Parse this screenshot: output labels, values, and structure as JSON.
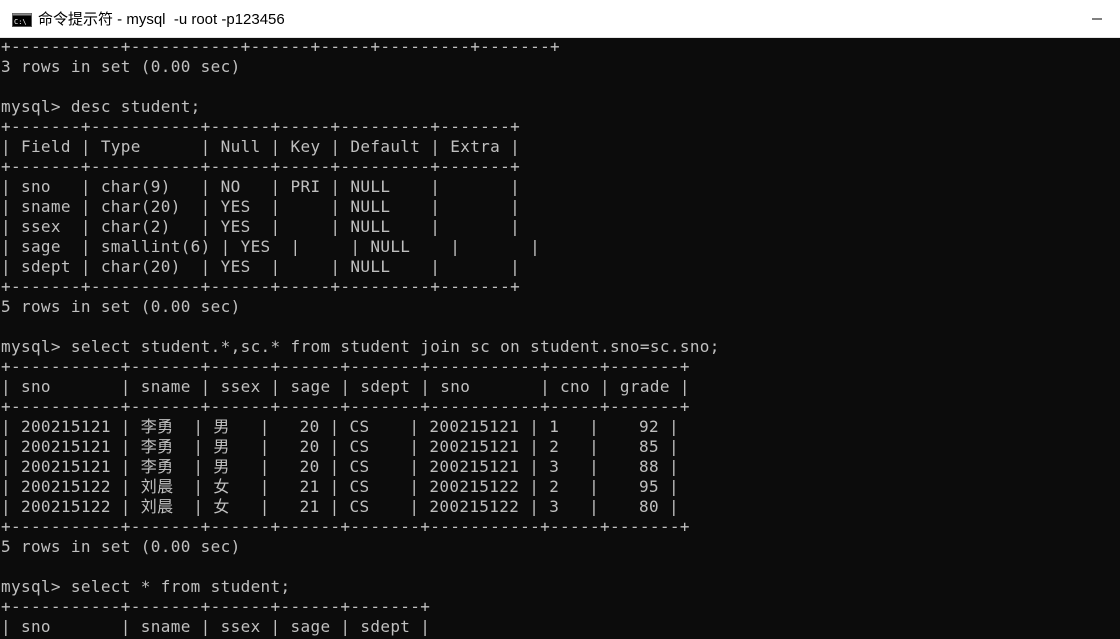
{
  "window": {
    "title": "命令提示符 - mysql  -u root -p123456",
    "icon": "cmd-icon",
    "controls": [
      "minimize-icon"
    ]
  },
  "colors": {
    "background": "#0c0c0c",
    "text": "#c0c0c0",
    "titlebar": "#ffffff"
  },
  "console": {
    "lines": [
      "+-----------+-----------+------+-----+---------+-------+",
      "3 rows in set (0.00 sec)",
      "",
      "mysql> desc student;",
      "+-------+-----------+------+-----+---------+-------+",
      "| Field | Type      | Null | Key | Default | Extra |",
      "+-------+-----------+------+-----+---------+-------+",
      "| sno   | char(9)   | NO   | PRI | NULL    |       |",
      "| sname | char(20)  | YES  |     | NULL    |       |",
      "| ssex  | char(2)   | YES  |     | NULL    |       |",
      "| sage  | smallint(6) | YES  |     | NULL    |       |",
      "| sdept | char(20)  | YES  |     | NULL    |       |",
      "+-------+-----------+------+-----+---------+-------+",
      "5 rows in set (0.00 sec)",
      "",
      "mysql> select student.*,sc.* from student join sc on student.sno=sc.sno;",
      "+-----------+-------+------+------+-------+-----------+-----+-------+",
      "| sno       | sname | ssex | sage | sdept | sno       | cno | grade |",
      "+-----------+-------+------+------+-------+-----------+-----+-------+",
      "| 200215121 | 李勇  | 男   |   20 | CS    | 200215121 | 1   |    92 |",
      "| 200215121 | 李勇  | 男   |   20 | CS    | 200215121 | 2   |    85 |",
      "| 200215121 | 李勇  | 男   |   20 | CS    | 200215121 | 3   |    88 |",
      "| 200215122 | 刘晨  | 女   |   21 | CS    | 200215122 | 2   |    95 |",
      "| 200215122 | 刘晨  | 女   |   21 | CS    | 200215122 | 3   |    80 |",
      "+-----------+-------+------+------+-------+-----------+-----+-------+",
      "5 rows in set (0.00 sec)",
      "",
      "mysql> select * from student;",
      "+-----------+-------+------+------+-------+",
      "| sno       | sname | ssex | sage | sdept |"
    ]
  }
}
